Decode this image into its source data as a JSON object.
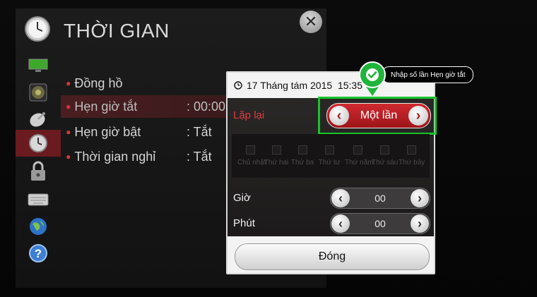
{
  "header": {
    "title": "THỜI GIAN",
    "title_icon": "clock-icon",
    "close_icon": "close-icon"
  },
  "sidebar": {
    "items": [
      {
        "icon": "picture-icon"
      },
      {
        "icon": "speaker-icon"
      },
      {
        "icon": "satellite-dish-icon"
      },
      {
        "icon": "clock-icon",
        "active": true
      },
      {
        "icon": "lock-icon"
      },
      {
        "icon": "keyboard-icon"
      },
      {
        "icon": "globe-icon"
      },
      {
        "icon": "help-icon"
      }
    ]
  },
  "menu": {
    "items": [
      {
        "label": "Đồng hồ",
        "value": ""
      },
      {
        "label": "Hẹn giờ tắt",
        "value": ": 00:00",
        "selected": true
      },
      {
        "label": "Hẹn giờ bật",
        "value": ": Tắt"
      },
      {
        "label": "Thời gian nghỉ",
        "value": ": Tắt"
      }
    ]
  },
  "dialog": {
    "datetime": "17 Tháng tám 2015  15:35",
    "repeat_label": "Lặp lại",
    "repeat_value": "Một lần",
    "days": [
      "Chủ nhật",
      "Thứ hai",
      "Thứ ba",
      "Thứ tư",
      "Thứ năm",
      "Thứ sáu",
      "Thứ bảy"
    ],
    "hour_label": "Giờ",
    "hour_value": "00",
    "minute_label": "Phút",
    "minute_value": "00",
    "close_label": "Đóng"
  },
  "callout": {
    "text": "Nhập số lần Hẹn giờ tắt",
    "color": "#1fb43a"
  },
  "colors": {
    "accent_red": "#cf2a30",
    "highlight_green": "#17c42a"
  }
}
